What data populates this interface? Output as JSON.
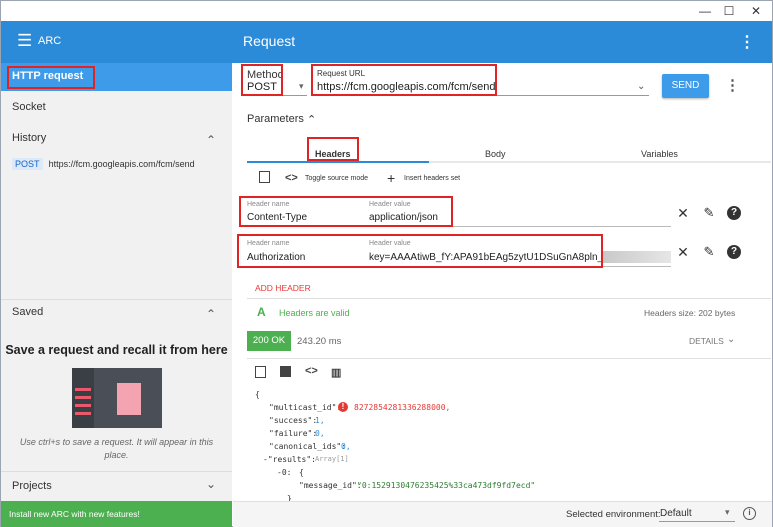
{
  "window": {
    "minimize": "—",
    "maximize": "☐",
    "close": "✕"
  },
  "appbar": {
    "menu_icon": "☰",
    "app_name": "ARC",
    "title": "Request",
    "more_icon": "⋮"
  },
  "sidebar": {
    "http_request": "HTTP request",
    "socket": "Socket",
    "history": "History",
    "history_items": [
      {
        "method": "POST",
        "url": "https://fcm.googleapis.com/fcm/send"
      }
    ],
    "saved": "Saved",
    "save_title": "Save a request and recall it from here",
    "save_hint": "Use ctrl+s to save a request. It will appear in this place.",
    "projects": "Projects",
    "collapse_icon": "⌃",
    "expand_icon": "⌄"
  },
  "request": {
    "method_label": "Method",
    "method": "POST",
    "url_label": "Request URL",
    "url": "https://fcm.googleapis.com/fcm/send",
    "send": "SEND",
    "parameters": "Parameters"
  },
  "tabs": [
    "Headers",
    "Body",
    "Variables"
  ],
  "headers_toolbar": {
    "toggle_source": "Toggle source mode",
    "insert_set": "Insert headers set"
  },
  "headers": [
    {
      "name_label": "Header name",
      "name": "Content-Type",
      "value_label": "Header value",
      "value": "application/json"
    },
    {
      "name_label": "Header name",
      "name": "Authorization",
      "value_label": "Header value",
      "value": "key=AAAAtiwB_fY:APA91bEAg5zytU1DSuGnA8pln_"
    }
  ],
  "add_header": "ADD HEADER",
  "validation": {
    "text": "Headers are valid",
    "size": "Headers size: 202 bytes"
  },
  "response": {
    "status": "200 OK",
    "time": "243.20 ms",
    "details": "DETAILS",
    "json": {
      "open": "{",
      "multicast_key": "\"multicast_id\":",
      "multicast_val": "8272854281336288000,",
      "success_key": "\"success\":",
      "success_val": "1,",
      "failure_key": "\"failure\":",
      "failure_val": "0,",
      "canonical_key": "\"canonical_ids\":",
      "canonical_val": "0,",
      "results_key": "-\"results\":",
      "results_meta": "Array[1]",
      "item_index": "-0:",
      "item_open": "{",
      "message_key": "\"message_id\":",
      "message_val": "\"0:1529130476235425%33ca473df9fd7ecd\"",
      "item_close": "}"
    }
  },
  "footer": {
    "new_features": "Install new ARC with new features!",
    "env_label": "Selected environment:",
    "env_value": "Default"
  },
  "colors": {
    "accent": "#2c8bd8",
    "send": "#3d9be9",
    "success": "#4caf50",
    "error": "#e53935"
  }
}
